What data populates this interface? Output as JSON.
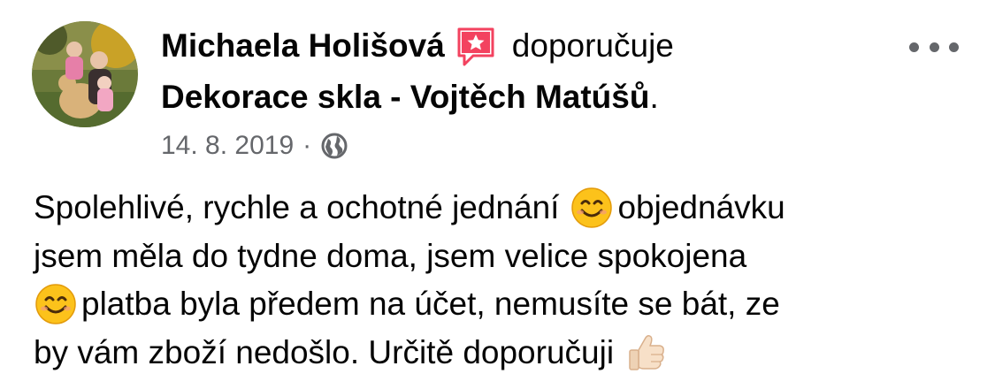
{
  "post": {
    "author": "Michaela Holišová",
    "action": "doporučuje",
    "page_name": "Dekorace skla - Vojtěch Matúšů",
    "period": ".",
    "date": "14. 8. 2019",
    "separator": "·",
    "privacy_icon": "globe-icon",
    "recommend_icon": "recommendation-star-icon",
    "more_icon": "more-options-icon",
    "body": {
      "line1_a": "Spolehlivé, rychle a ochotné jednání",
      "line1_b": "objednávku",
      "line2": "jsem měla do tydne doma, jsem velice spokojena",
      "line3": "platba byla předem na účet, nemusíte se bát, ze",
      "line4": "by vám zboží nedošlo. Určitě doporučuji"
    },
    "emojis": {
      "smile": "smiling-face-emoji",
      "thumbs": "thumbs-up-emoji"
    }
  },
  "colors": {
    "text": "#050505",
    "secondary": "#65676b",
    "recommend": "#f3425f"
  }
}
